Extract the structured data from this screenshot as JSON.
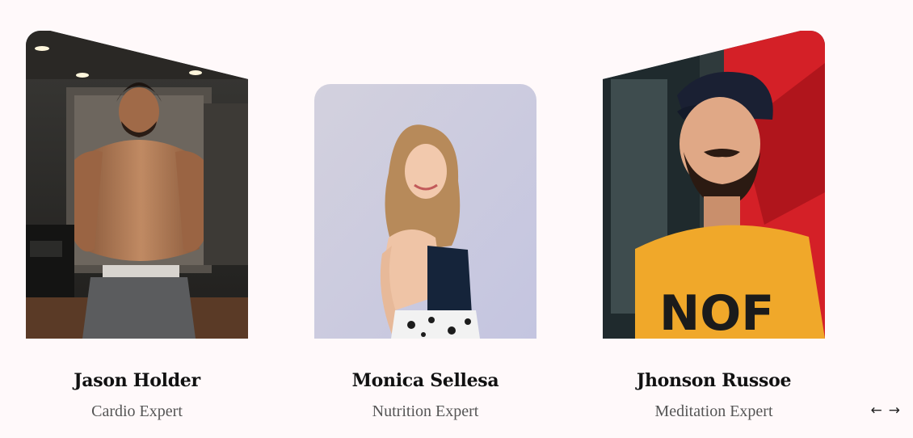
{
  "team": [
    {
      "name": "Jason Holder",
      "role": "Cardio Expert",
      "photo_alt": "Jason Holder photo"
    },
    {
      "name": "Monica Sellesa",
      "role": "Nutrition Expert",
      "photo_alt": "Monica Sellesa photo"
    },
    {
      "name": "Jhonson Russoe",
      "role": "Meditation Expert",
      "photo_alt": "Jhonson Russoe photo"
    }
  ],
  "nav": {
    "prev_label": "←",
    "next_label": "→"
  },
  "colors": {
    "background": "#fff9fa",
    "name_text": "#111111",
    "role_text": "#555555",
    "accent_red": "#d42027",
    "shirt_yellow": "#f0a82a"
  }
}
